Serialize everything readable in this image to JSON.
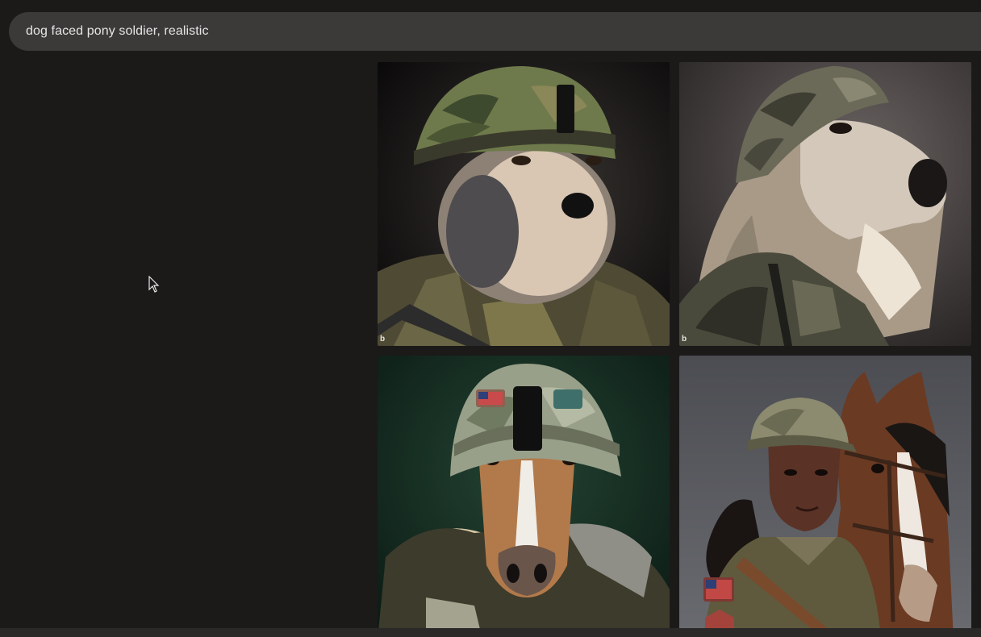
{
  "search": {
    "query": "dog faced pony soldier, realistic"
  },
  "results": [
    {
      "name": "dog-soldier-camo-helmet",
      "badge": "b"
    },
    {
      "name": "pony-soldier-camo-helmet-side",
      "badge": "b"
    },
    {
      "name": "pony-soldier-front-helmet",
      "badge": ""
    },
    {
      "name": "woman-soldier-with-horse",
      "badge": ""
    }
  ],
  "colors": {
    "background": "#1b1a19",
    "search_bg": "#3b3a39",
    "search_text": "#e6e6e6"
  }
}
